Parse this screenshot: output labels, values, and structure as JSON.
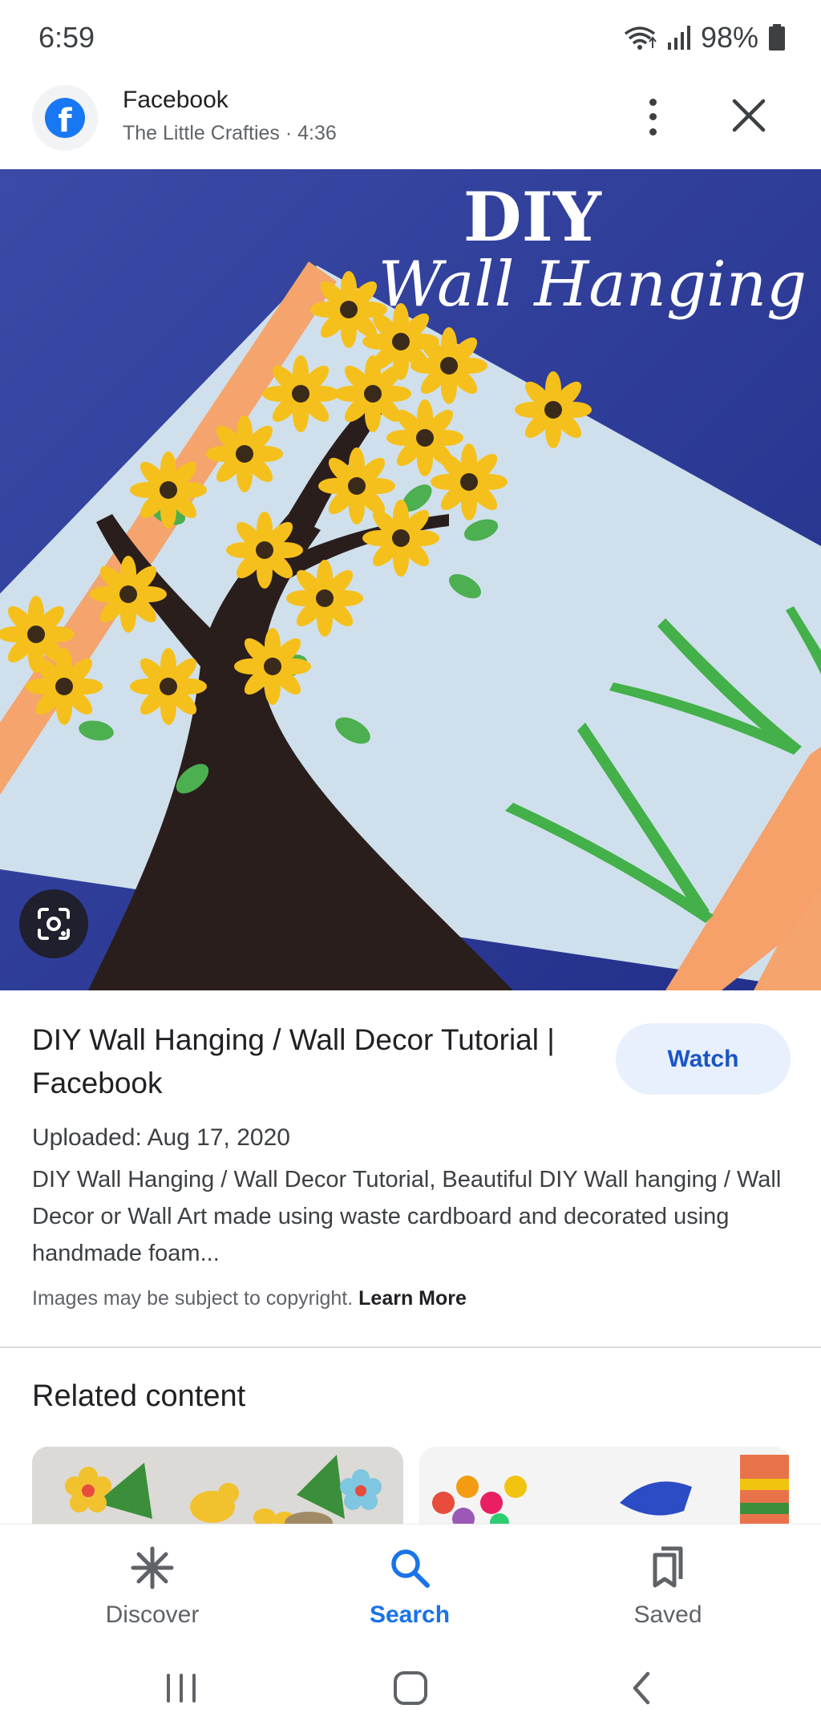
{
  "status_bar": {
    "time": "6:59",
    "battery": "98%"
  },
  "header": {
    "source_name": "Facebook",
    "subtitle": "The Little Crafties · 4:36",
    "icons": [
      "facebook-logo",
      "more-vert-icon",
      "close-icon"
    ]
  },
  "hero": {
    "title_line1": "DIY",
    "title_line2": "Wall Hanging"
  },
  "result": {
    "title": "DIY Wall Hanging / Wall Decor Tutorial | Facebook",
    "watch_label": "Watch",
    "uploaded": "Uploaded: Aug 17, 2020",
    "description": "DIY Wall Hanging / Wall Decor Tutorial, Beautiful DIY Wall hanging / Wall Decor or Wall Art made using waste cardboard and decorated using handmade foam...",
    "copyright_text": "Images may be subject to copyright.",
    "learn_more": "Learn More"
  },
  "related": {
    "title": "Related content"
  },
  "bottom_nav": {
    "items": [
      {
        "label": "Discover",
        "icon": "asterisk-icon"
      },
      {
        "label": "Search",
        "icon": "search-icon",
        "active": true
      },
      {
        "label": "Saved",
        "icon": "bookmarks-icon"
      }
    ]
  },
  "colors": {
    "accent": "#1a73e8",
    "watch_bg": "#e8f0fe",
    "image_bg": "#2e3a93"
  }
}
